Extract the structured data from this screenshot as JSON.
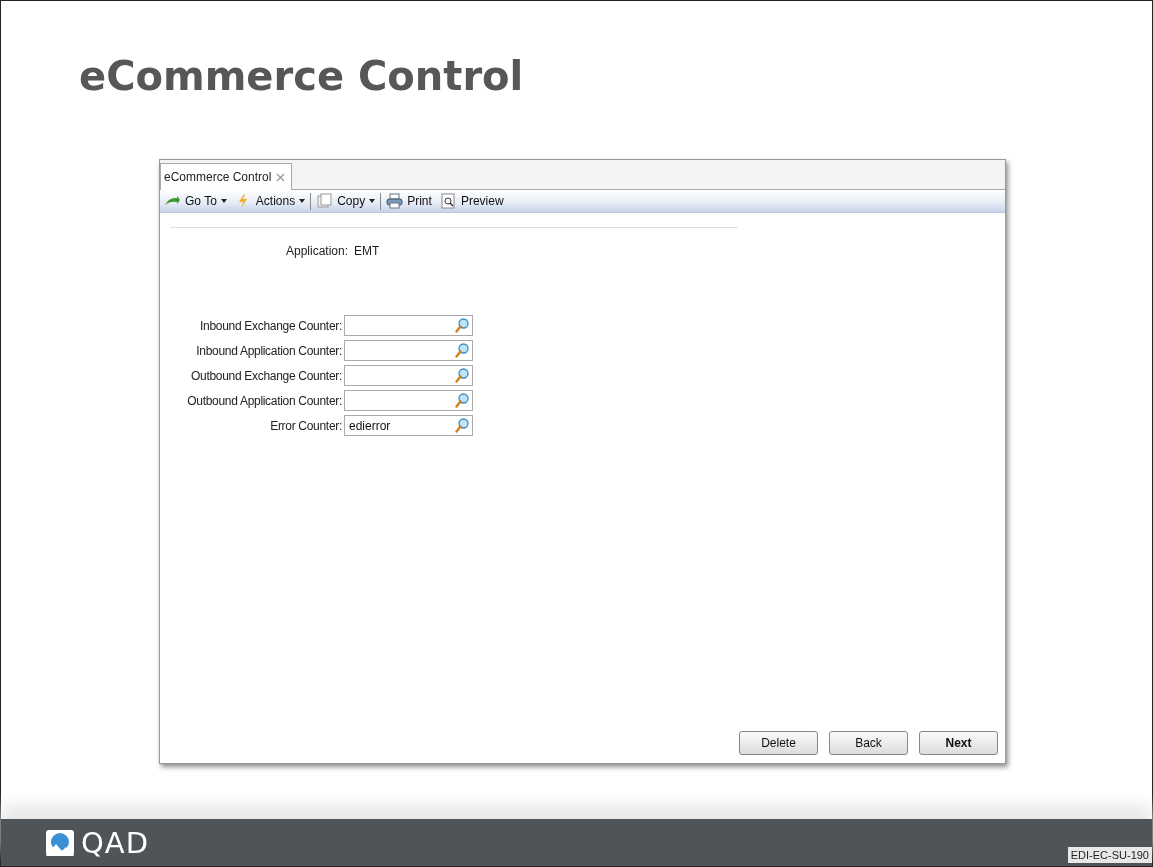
{
  "slide": {
    "title": "eCommerce Control",
    "footer_code": "EDI-EC-SU-190",
    "logo_text": "QAD"
  },
  "window": {
    "tabs": [
      {
        "label": "eCommerce Control",
        "selected": true
      }
    ],
    "toolbar": [
      {
        "label": "Go To",
        "kind": "menu",
        "separator_after": false
      },
      {
        "label": "Actions",
        "kind": "menu",
        "separator_after": true
      },
      {
        "label": "Copy",
        "kind": "menu",
        "separator_after": true
      },
      {
        "label": "Print",
        "kind": "button",
        "separator_after": false
      },
      {
        "label": "Preview",
        "kind": "button",
        "separator_after": false
      }
    ],
    "application": {
      "label": "Application:",
      "value": "EMT"
    },
    "fields": [
      {
        "label": "Inbound Exchange Counter:"
      },
      {
        "label": "Inbound Application Counter:"
      },
      {
        "label": "Outbound Exchange Counter:"
      },
      {
        "label": "Outbound Application Counter:"
      },
      {
        "label": "Error Counter:",
        "value": "edierror"
      }
    ],
    "buttons": [
      {
        "label": "Delete",
        "default": false
      },
      {
        "label": "Back",
        "default": false
      },
      {
        "label": "Next",
        "default": true
      }
    ]
  }
}
